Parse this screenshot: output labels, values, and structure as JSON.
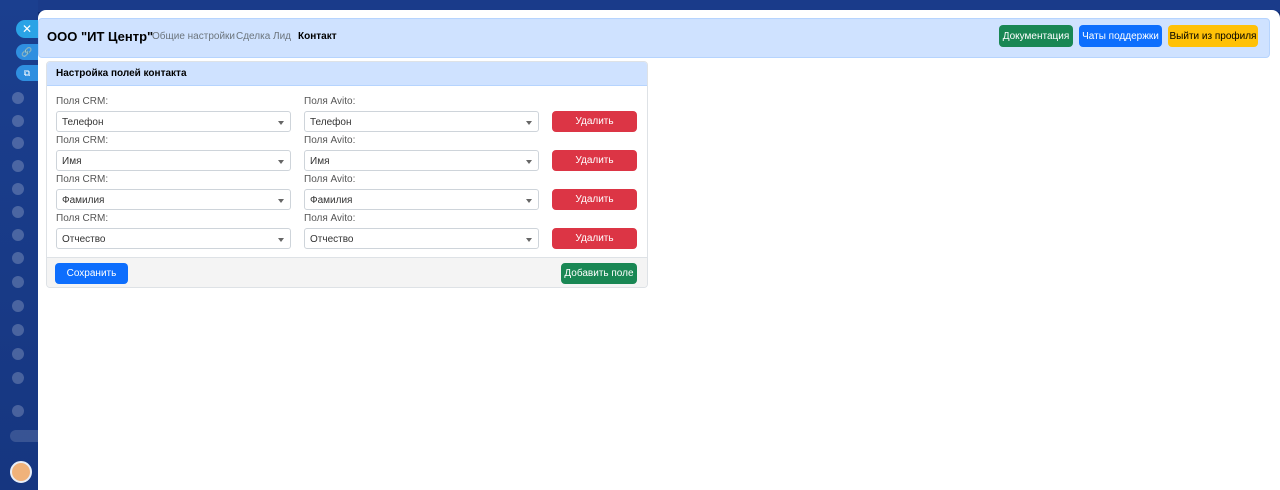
{
  "navbar": {
    "brand": "ООО \"ИТ Центр\"",
    "links": [
      "Общие настройки",
      "Сделка",
      "Лид",
      "Контакт"
    ],
    "active_link": "Контакт",
    "buttons": {
      "docs": "Документация",
      "support": "Чаты поддержки",
      "logout": "Выйти из профиля"
    }
  },
  "card": {
    "title": "Настройка полей контакта",
    "crm_label": "Поля CRM:",
    "avito_label": "Поля Avito:",
    "delete_label": "Удалить",
    "rows": [
      {
        "crm": "Телефон",
        "avito": "Телефон"
      },
      {
        "crm": "Имя",
        "avito": "Имя"
      },
      {
        "crm": "Фамилия",
        "avito": "Фамилия"
      },
      {
        "crm": "Отчество",
        "avito": "Отчество"
      }
    ],
    "save_label": "Сохранить",
    "add_label": "Добавить поле"
  },
  "colors": {
    "navbar_bg": "#cfe2ff",
    "success": "#198754",
    "primary": "#0d6efd",
    "warning": "#ffc107",
    "danger": "#dc3545"
  },
  "icons": [
    "close-icon",
    "link-icon",
    "external-link-icon",
    "avatar"
  ]
}
